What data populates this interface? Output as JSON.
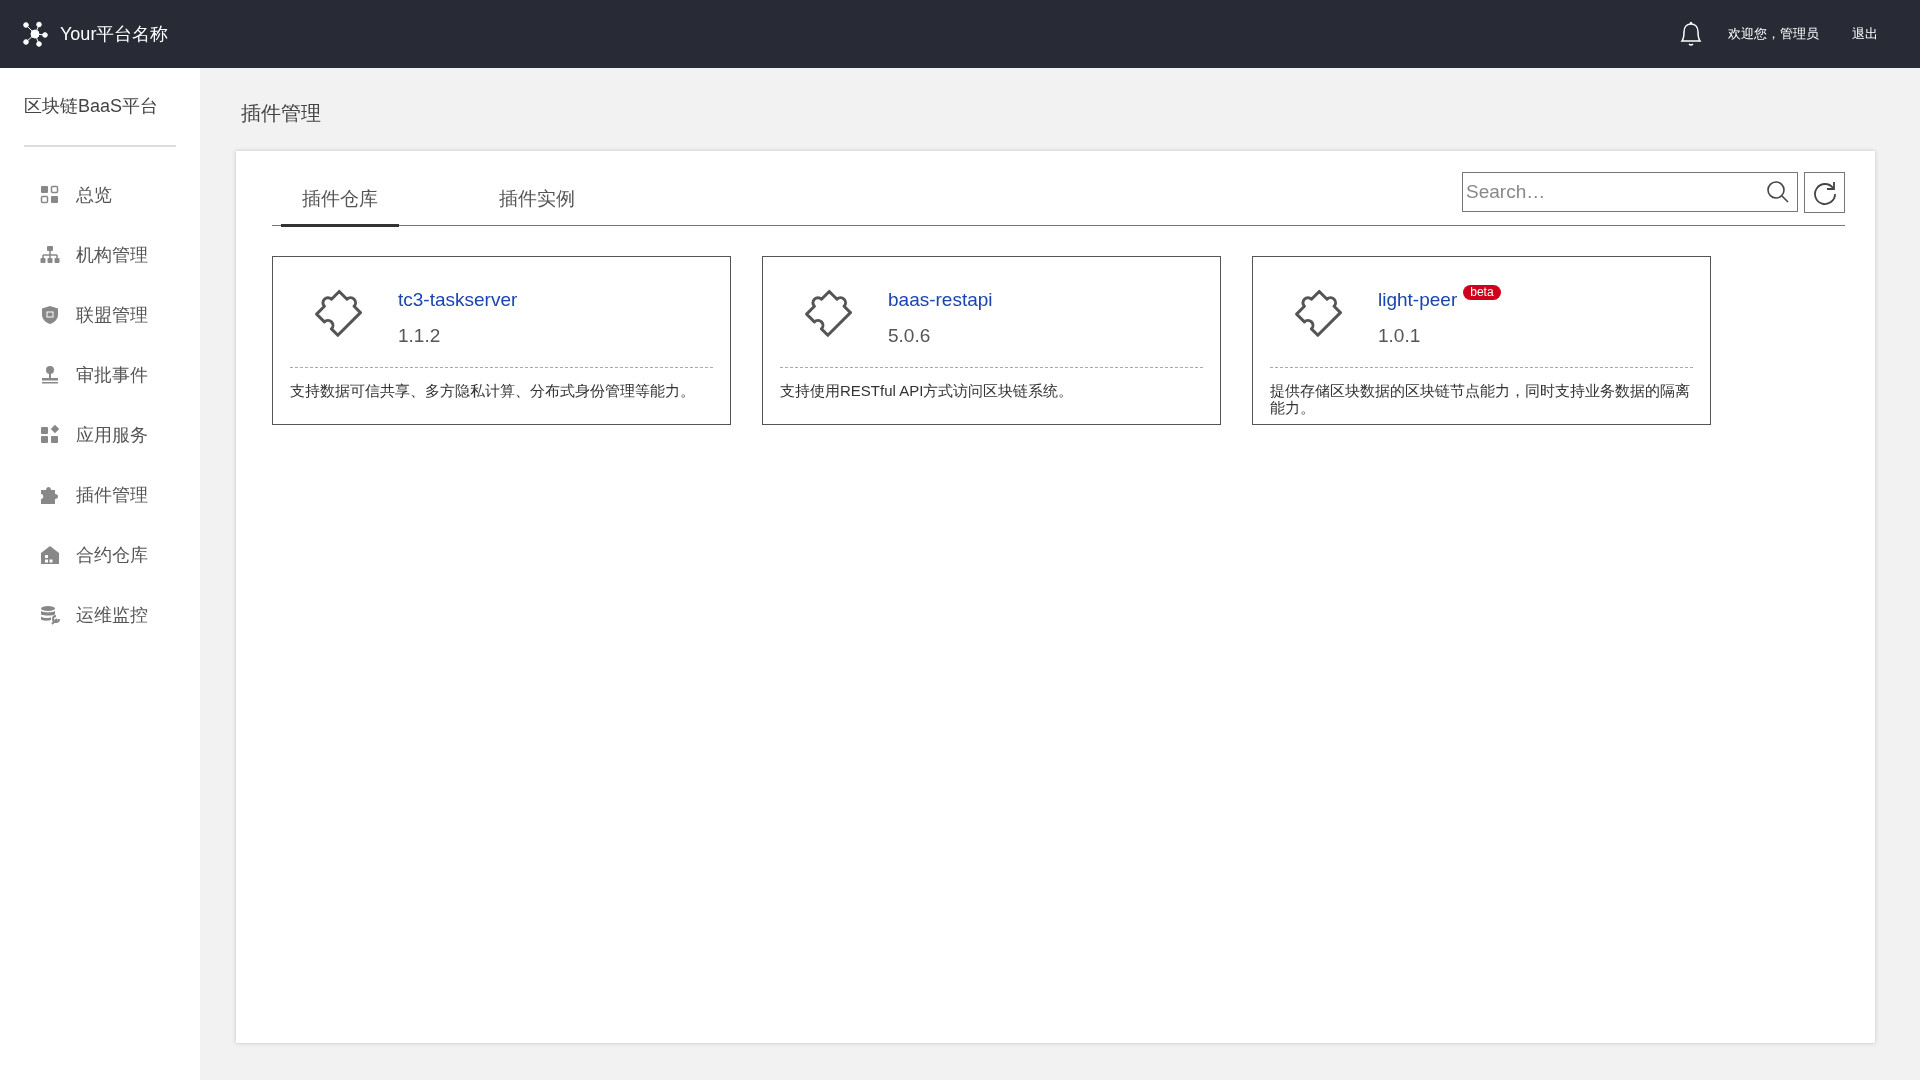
{
  "header": {
    "brand": "Your平台名称",
    "welcome": "欢迎您，管理员",
    "logout": "退出"
  },
  "sidebar": {
    "title": "区块链BaaS平台",
    "items": [
      {
        "label": "总览"
      },
      {
        "label": "机构管理"
      },
      {
        "label": "联盟管理"
      },
      {
        "label": "审批事件"
      },
      {
        "label": "应用服务"
      },
      {
        "label": "插件管理"
      },
      {
        "label": "合约仓库"
      },
      {
        "label": "运维监控"
      }
    ]
  },
  "page_title": "插件管理",
  "tabs": [
    {
      "label": "插件仓库",
      "selected": true
    },
    {
      "label": "插件实例",
      "selected": false
    }
  ],
  "search": {
    "placeholder": "Search…"
  },
  "plugins": [
    {
      "name": "tc3-taskserver",
      "version": "1.1.2",
      "description": "支持数据可信共享、多方隐私计算、分布式身份管理等能力。"
    },
    {
      "name": "baas-restapi",
      "version": "5.0.6",
      "description": "支持使用RESTful API方式访问区块链系统。"
    },
    {
      "name": "light-peer",
      "badge": "beta",
      "version": "1.0.1",
      "description": "提供存储区块数据的区块链节点能力，同时支持业务数据的隔离能力。"
    }
  ]
}
